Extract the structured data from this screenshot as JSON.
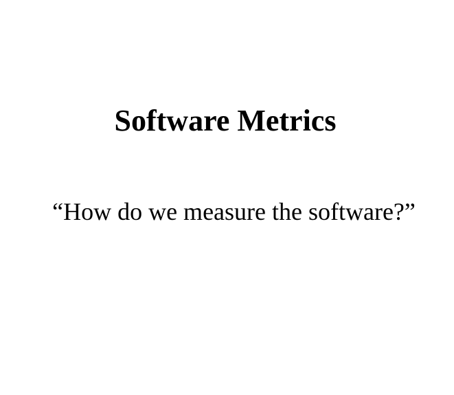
{
  "slide": {
    "title": "Software Metrics",
    "subtitle": "“How do we measure the software?”"
  },
  "colors": {
    "background": "#ffffff",
    "text": "#000000"
  }
}
